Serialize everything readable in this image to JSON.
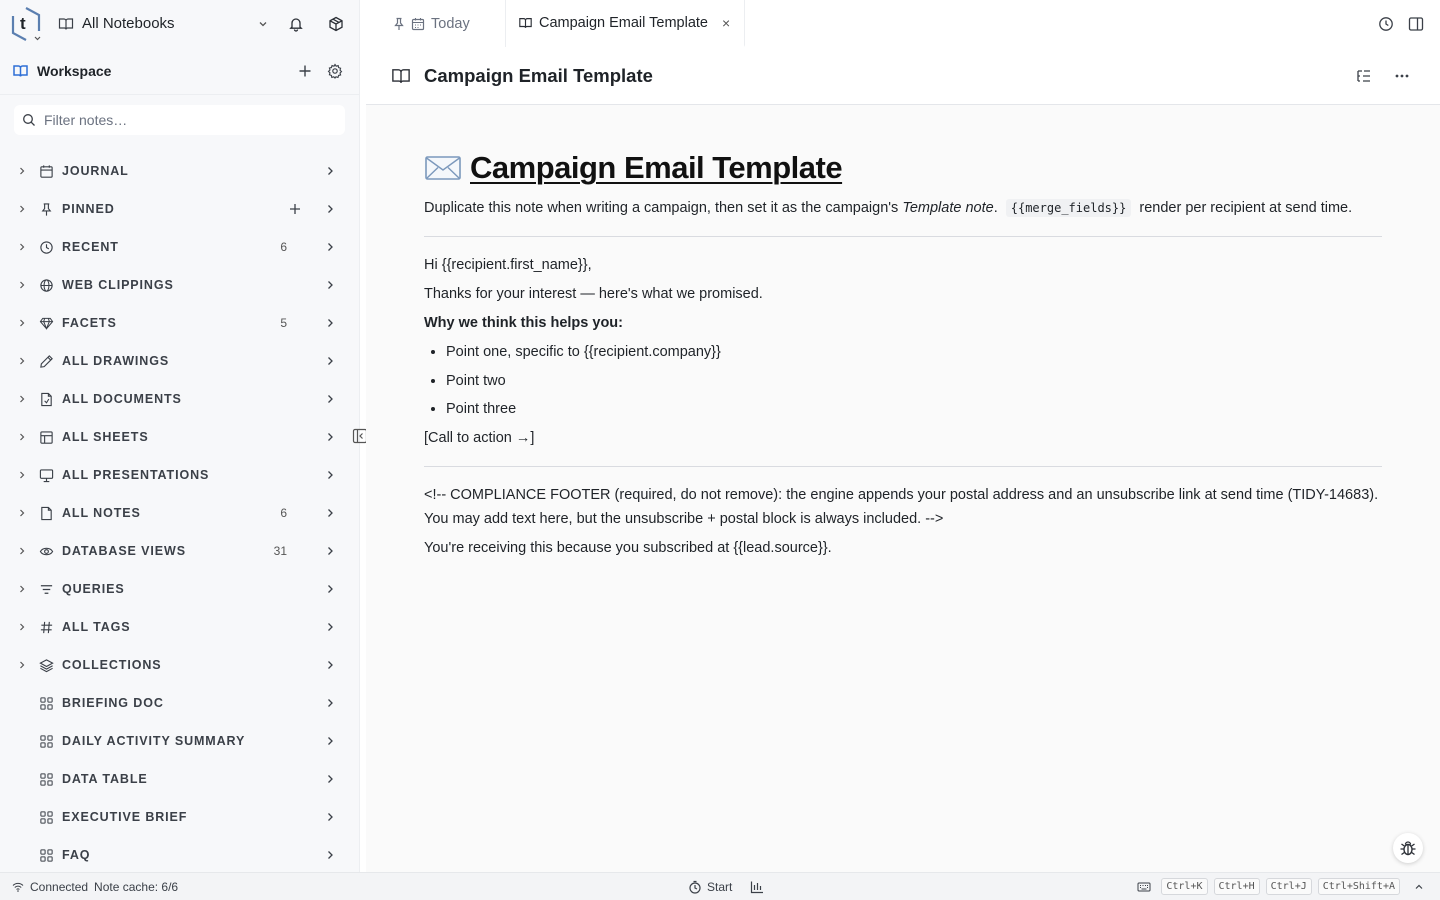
{
  "topbar": {
    "notebook_label": "All Notebooks"
  },
  "workspace": {
    "title": "Workspace",
    "filter_placeholder": "Filter notes…"
  },
  "nav": [
    {
      "label": "JOURNAL",
      "icon": "calendar-icon",
      "count": "",
      "expandable": true
    },
    {
      "label": "PINNED",
      "icon": "pin-icon",
      "count": "",
      "expandable": true,
      "plus": true
    },
    {
      "label": "RECENT",
      "icon": "clock-icon",
      "count": "6",
      "expandable": true
    },
    {
      "label": "WEB CLIPPINGS",
      "icon": "globe-icon",
      "count": "",
      "expandable": true
    },
    {
      "label": "FACETS",
      "icon": "diamond-icon",
      "count": "5",
      "expandable": true
    },
    {
      "label": "ALL DRAWINGS",
      "icon": "pencil-icon",
      "count": "",
      "expandable": true
    },
    {
      "label": "ALL DOCUMENTS",
      "icon": "document-icon",
      "count": "",
      "expandable": true
    },
    {
      "label": "ALL SHEETS",
      "icon": "table-icon",
      "count": "",
      "expandable": true
    },
    {
      "label": "ALL PRESENTATIONS",
      "icon": "presentation-icon",
      "count": "",
      "expandable": true
    },
    {
      "label": "ALL NOTES",
      "icon": "file-icon",
      "count": "6",
      "expandable": true
    },
    {
      "label": "DATABASE VIEWS",
      "icon": "eye-icon",
      "count": "31",
      "expandable": true
    },
    {
      "label": "QUERIES",
      "icon": "filter-icon",
      "count": "",
      "expandable": true
    },
    {
      "label": "ALL TAGS",
      "icon": "hash-icon",
      "count": "",
      "expandable": true
    },
    {
      "label": "COLLECTIONS",
      "icon": "layers-icon",
      "count": "",
      "expandable": true
    },
    {
      "label": "BRIEFING DOC",
      "icon": "grid-icon",
      "count": "",
      "expandable": false
    },
    {
      "label": "DAILY ACTIVITY SUMMARY",
      "icon": "grid-icon",
      "count": "",
      "expandable": false
    },
    {
      "label": "DATA TABLE",
      "icon": "grid-icon",
      "count": "",
      "expandable": false
    },
    {
      "label": "EXECUTIVE BRIEF",
      "icon": "grid-icon",
      "count": "",
      "expandable": false
    },
    {
      "label": "FAQ",
      "icon": "grid-icon",
      "count": "",
      "expandable": false
    }
  ],
  "tabs": {
    "today": "Today",
    "active": "Campaign Email Template",
    "close": "×"
  },
  "note": {
    "header_title": "Campaign Email Template",
    "emoji": "✉",
    "title": "Campaign Email Template",
    "intro_before": "Duplicate this note when writing a campaign, then set it as the campaign's ",
    "intro_em": "Template note",
    "intro_dot": ".",
    "intro_code": "{{merge_fields}}",
    "intro_after": "render per recipient at send time.",
    "greeting": "Hi {{recipient.first_name}},",
    "thanks": "Thanks for your interest — here's what we promised.",
    "why": "Why we think this helps you:",
    "bullets": [
      "Point one, specific to {{recipient.company}}",
      "Point two",
      "Point three"
    ],
    "cta": "[Call to action →]",
    "compliance": "<!-- COMPLIANCE FOOTER (required, do not remove): the engine appends your postal address and an unsubscribe link at send time (TIDY-14683). You may add text here, but the unsubscribe + postal block is always included. -->",
    "receiving": "You're receiving this because you subscribed at {{lead.source}}."
  },
  "status": {
    "connected": "Connected",
    "cache": "Note cache: 6/6",
    "start": "Start",
    "shortcuts": [
      "Ctrl+K",
      "Ctrl+H",
      "Ctrl+J",
      "Ctrl+Shift+A"
    ]
  }
}
